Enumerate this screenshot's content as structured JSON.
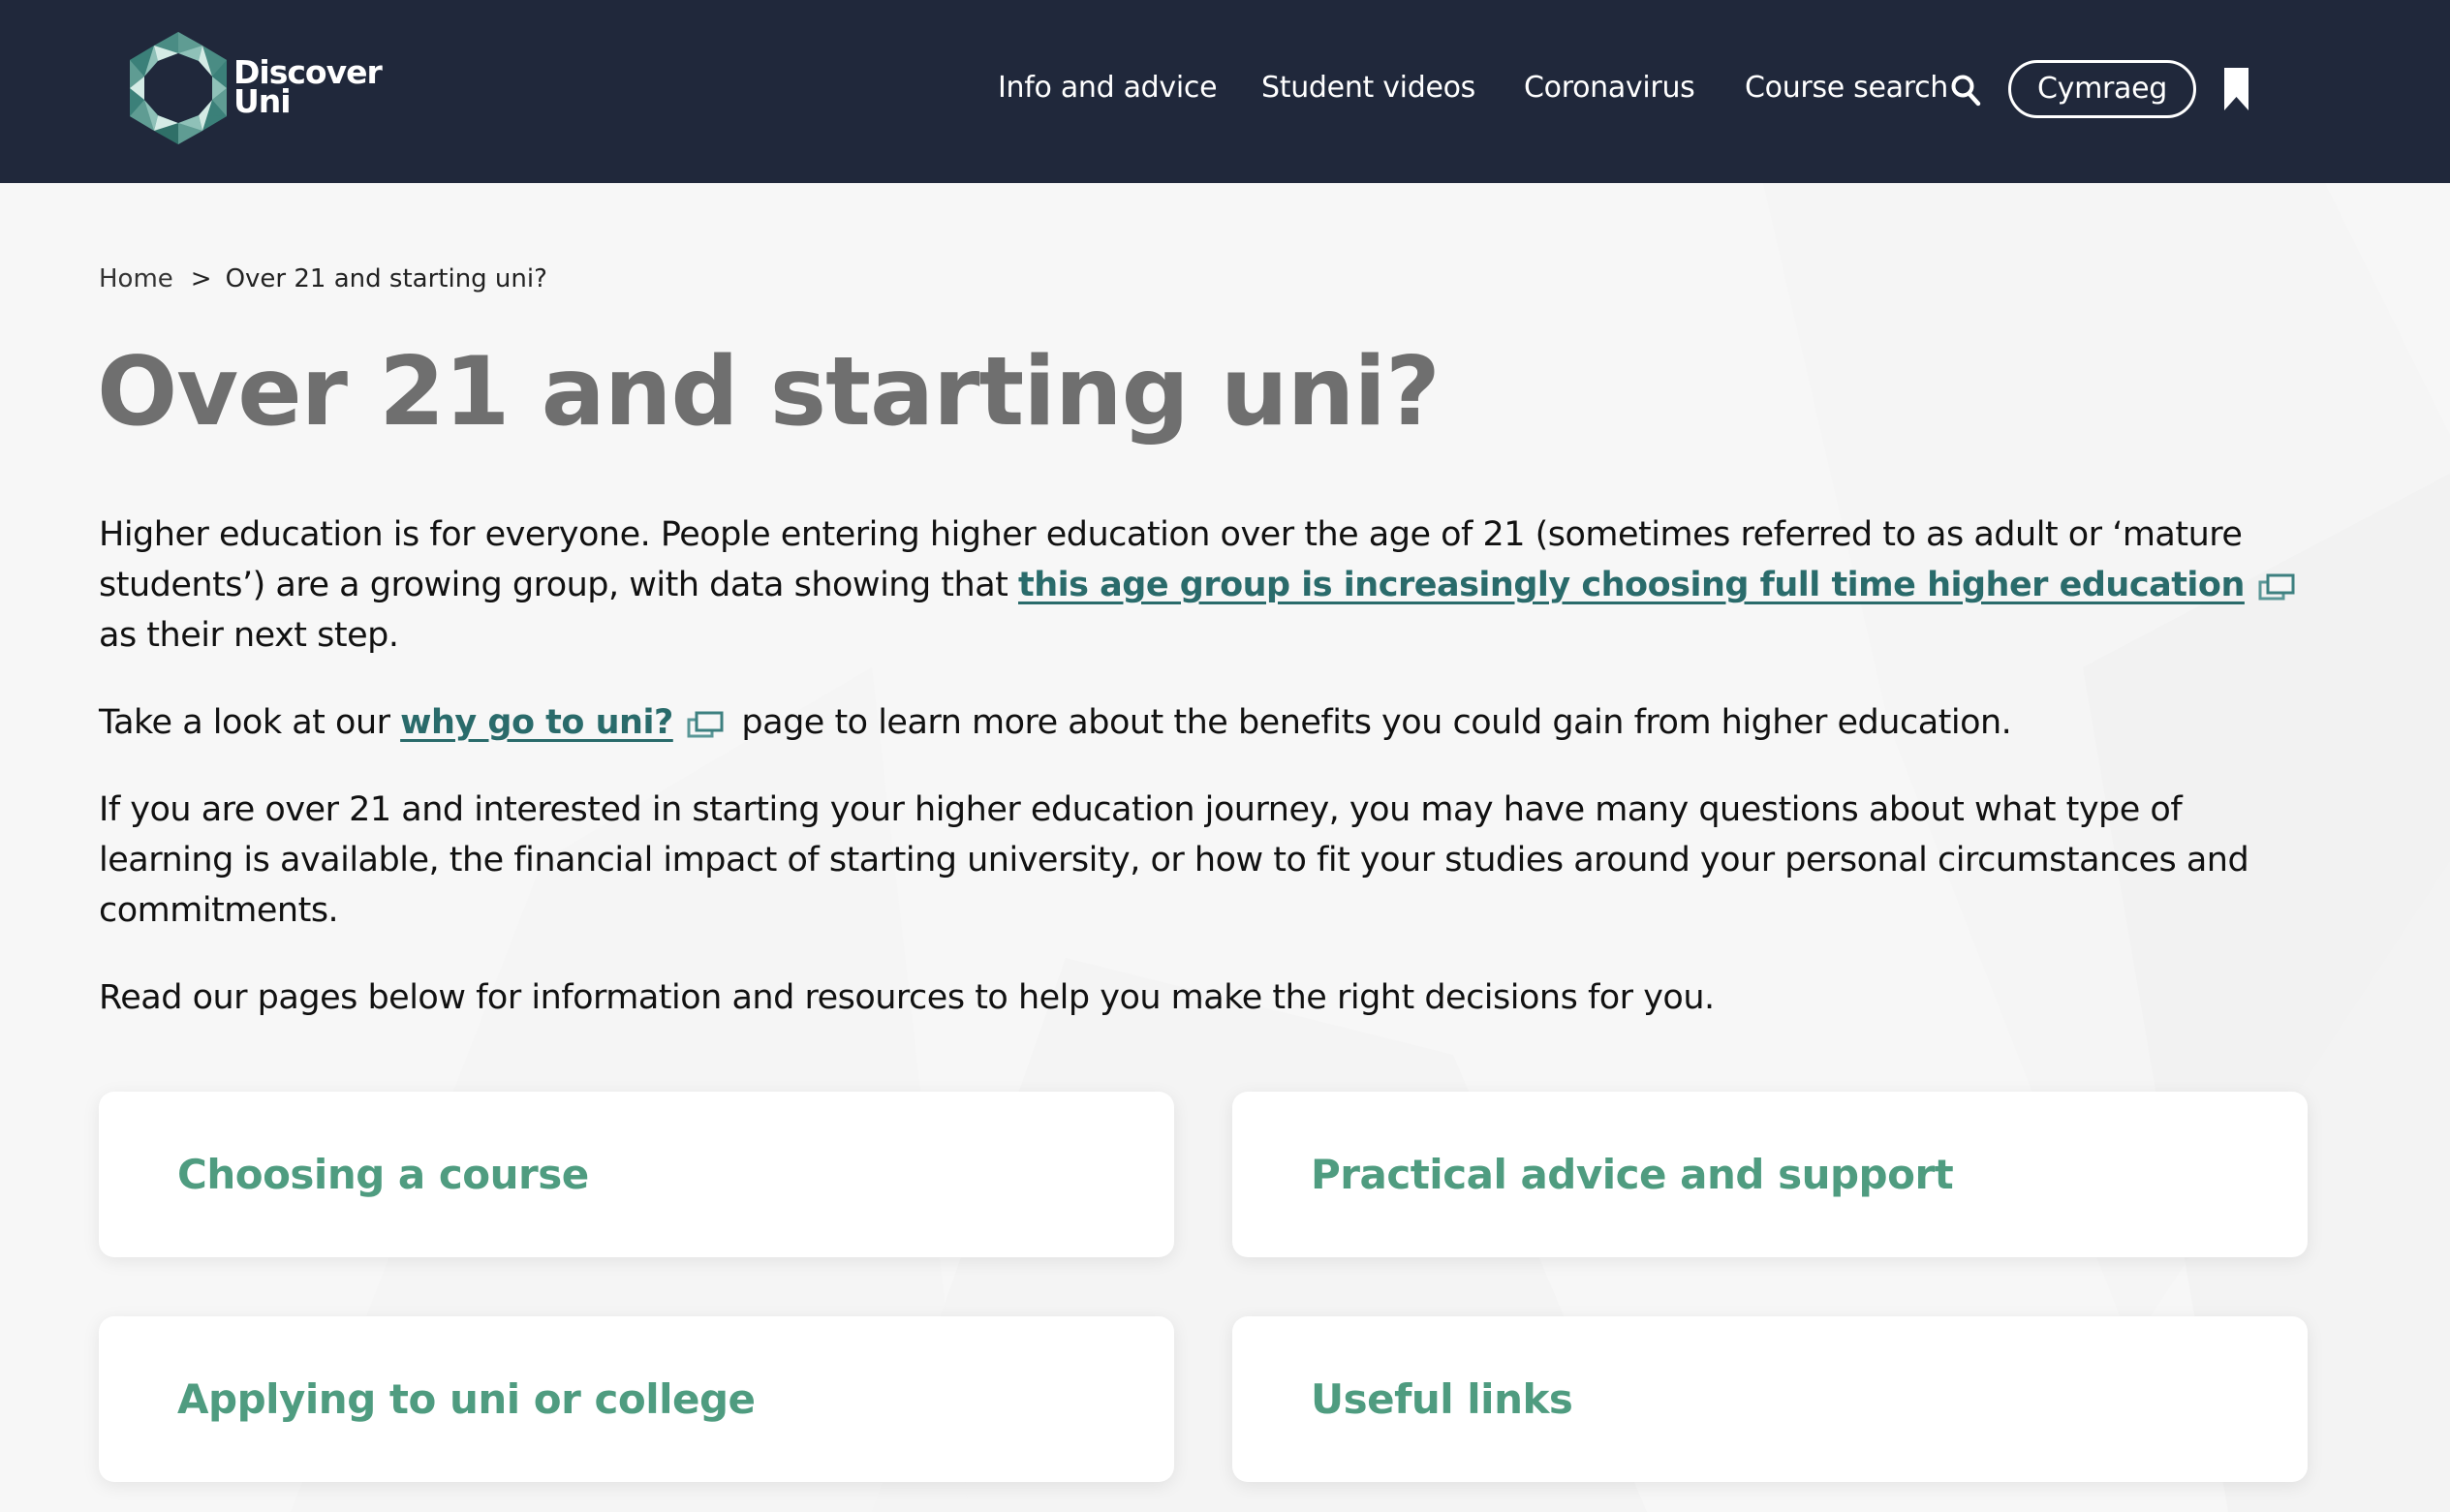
{
  "header": {
    "logo": {
      "line1": "Discover",
      "line2": "Uni"
    },
    "nav": [
      {
        "label": "Info and advice"
      },
      {
        "label": "Student videos"
      },
      {
        "label": "Coronavirus"
      },
      {
        "label": "Course search",
        "icon": "search-icon"
      }
    ],
    "language_button": "Cymraeg",
    "bookmark_icon": "bookmark-icon",
    "colors": {
      "background": "#20283b",
      "text": "#ffffff"
    }
  },
  "breadcrumb": {
    "items": [
      "Home",
      "Over 21 and starting uni?"
    ],
    "separator": ">"
  },
  "page_title": "Over 21 and starting uni?",
  "content": {
    "p1": {
      "before": "Higher education is for everyone. People entering higher education over the age of 21 (sometimes referred to as adult or ‘mature students’) are a growing group, with data showing that ",
      "link": "this age group is increasingly choosing full time higher education",
      "after": " as their next step."
    },
    "p2": {
      "before": "Take a look at our ",
      "link": "why go to uni?",
      "after": " page to learn more about the benefits you could gain from higher education."
    },
    "p3": "If you are over 21 and interested in starting your higher education journey, you may have many questions about what type of learning is available, the financial impact of starting university, or how to fit your studies around your personal circumstances and commitments.",
    "p4": "Read our pages below for information and resources to help you make the right decisions for you.",
    "external_link_icon": "external-link-icon"
  },
  "cards": [
    {
      "label": "Choosing a course"
    },
    {
      "label": "Practical advice and support"
    },
    {
      "label": "Applying to uni or college"
    },
    {
      "label": "Useful links"
    }
  ],
  "colors": {
    "page_background": "#f7f7f7",
    "heading": "#6f6f6f",
    "link": "#2a6b6b",
    "card_text": "#4f9c80"
  }
}
